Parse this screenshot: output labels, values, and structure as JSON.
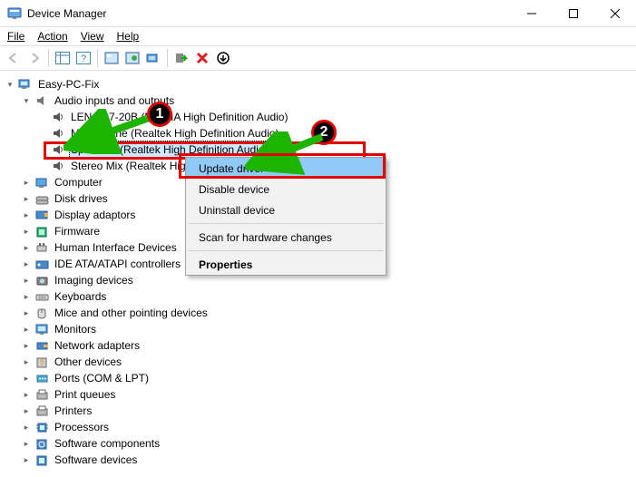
{
  "window": {
    "title": "Device Manager"
  },
  "menu": {
    "file": "File",
    "action": "Action",
    "view": "View",
    "help": "Help"
  },
  "tree": {
    "root": "Easy-PC-Fix",
    "audio_cat": "Audio inputs and outputs",
    "audio_items": {
      "d0": "LEN D27-20B (NVIDIA High Definition Audio)",
      "d1": "Microphone (Realtek High Definition Audio)",
      "d2": "Speakers (Realtek High Definition Audio)",
      "d3": "Stereo Mix (Realtek High Definition Audio)"
    },
    "cats": {
      "c0": "Computer",
      "c1": "Disk drives",
      "c2": "Display adaptors",
      "c3": "Firmware",
      "c4": "Human Interface Devices",
      "c5": "IDE ATA/ATAPI controllers",
      "c6": "Imaging devices",
      "c7": "Keyboards",
      "c8": "Mice and other pointing devices",
      "c9": "Monitors",
      "c10": "Network adapters",
      "c11": "Other devices",
      "c12": "Ports (COM & LPT)",
      "c13": "Print queues",
      "c14": "Printers",
      "c15": "Processors",
      "c16": "Software components",
      "c17": "Software devices"
    }
  },
  "context_menu": {
    "update": "Update driver",
    "disable": "Disable device",
    "uninstall": "Uninstall device",
    "scan": "Scan for hardware changes",
    "properties": "Properties"
  },
  "annotations": {
    "b1": "1",
    "b2": "2"
  }
}
